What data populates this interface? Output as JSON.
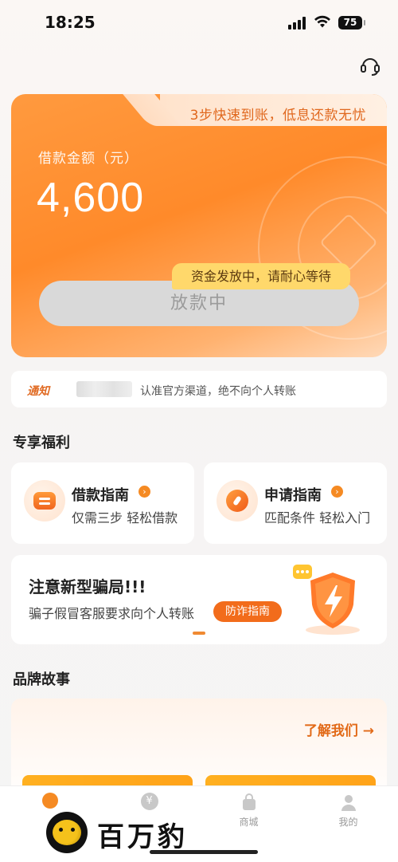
{
  "status_bar": {
    "time": "18:25",
    "battery": "75"
  },
  "loan_card": {
    "promo": "3步快速到账，低息还款无忧",
    "amount_label": "借款金额（元）",
    "amount": "4,600",
    "button_label": "放款中",
    "status_tip": "资金发放中，请耐心等待"
  },
  "notice": {
    "tag": "通知",
    "text": "认准官方渠道，绝不向个人转账"
  },
  "benefits": {
    "title": "专享福利",
    "items": [
      {
        "title": "借款指南",
        "subtitle": "仅需三步 轻松借款"
      },
      {
        "title": "申请指南",
        "subtitle": "匹配条件 轻松入门"
      }
    ]
  },
  "fraud": {
    "title": "注意新型骗局!!!",
    "subtitle": "骗子假冒客服要求向个人转账",
    "button": "防诈指南"
  },
  "brand": {
    "title": "品牌故事",
    "learn_more": "了解我们 →"
  },
  "tabbar": {
    "items": [
      {
        "label": ""
      },
      {
        "label": ""
      },
      {
        "label": "商城"
      },
      {
        "label": "我的"
      }
    ]
  },
  "watermark": {
    "text": "百万豹"
  },
  "colors": {
    "accent": "#f58a23",
    "card": "#ff8a2a",
    "tip": "#ffd86b"
  }
}
